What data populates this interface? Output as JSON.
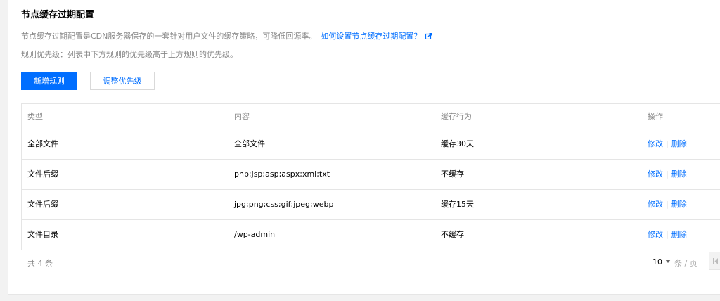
{
  "page": {
    "title": "节点缓存过期配置",
    "description": "节点缓存过期配置是CDN服务器保存的一套针对用户文件的缓存策略，可降低回源率。",
    "help_link": "如何设置节点缓存过期配置？",
    "priority_note": "规则优先级：列表中下方规则的优先级高于上方规则的优先级。"
  },
  "toolbar": {
    "add_label": "新增规则",
    "adjust_label": "调整优先级"
  },
  "table": {
    "headers": [
      "类型",
      "内容",
      "缓存行为",
      "操作"
    ],
    "rows": [
      {
        "type": "全部文件",
        "content": "全部文件",
        "behavior": "缓存30天",
        "edit": "修改",
        "delete": "删除"
      },
      {
        "type": "文件后缀",
        "content": "php;jsp;asp;aspx;xml;txt",
        "behavior": "不缓存",
        "edit": "修改",
        "delete": "删除"
      },
      {
        "type": "文件后缀",
        "content": "jpg;png;css;gif;jpeg;webp",
        "behavior": "缓存15天",
        "edit": "修改",
        "delete": "删除"
      },
      {
        "type": "文件目录",
        "content": "/wp-admin",
        "behavior": "不缓存",
        "edit": "修改",
        "delete": "删除"
      }
    ]
  },
  "pagination": {
    "total": "共 4 条",
    "page_size": "10",
    "per_page_label": "条 / 页"
  },
  "colors": {
    "primary": "#006eff",
    "muted_text": "#888888",
    "border": "#e5e5e5"
  },
  "icons": [
    "external-link-icon",
    "dropdown-caret-icon",
    "first-page-icon"
  ]
}
